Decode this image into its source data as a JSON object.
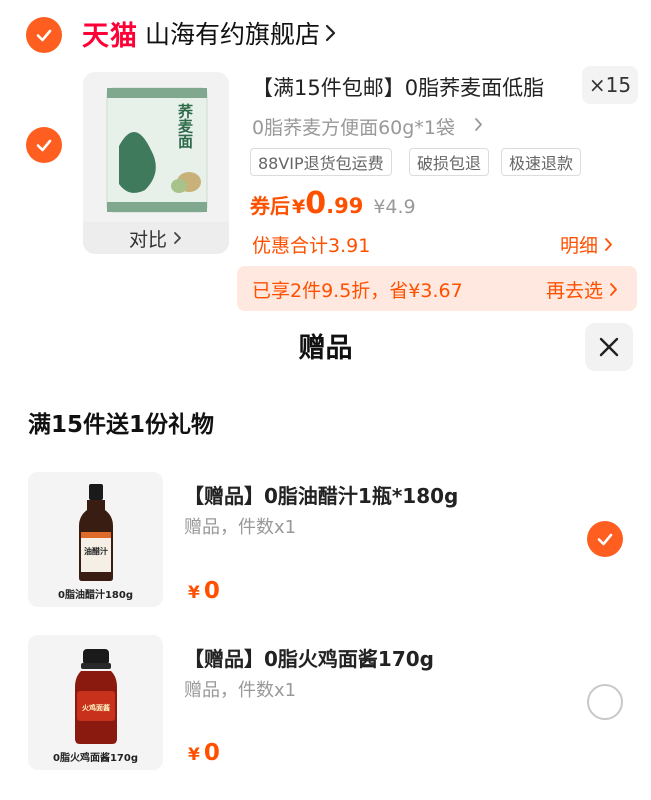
{
  "store": {
    "logo_text": "天猫",
    "name": "山海有约旗舰店"
  },
  "product": {
    "title": "【满15件包邮】0脂荞麦面低脂",
    "quantity": "×15",
    "sku": "0脂荞麦方便面60g*1袋",
    "thumb_text": "荞麦面",
    "compare_label": "对比",
    "tags": [
      "88VIP退货包运费",
      "破损包退",
      "极速退款"
    ],
    "price": {
      "label": "券后",
      "currency": "¥",
      "integer": "0",
      "decimal": ".99",
      "original": "¥4.9"
    },
    "discount_total": "优惠合计3.91",
    "detail_link": "明细",
    "promo": {
      "text": "已享2件9.5折，省¥3.67",
      "link": "再去选"
    }
  },
  "gift_sheet": {
    "title": "赠品",
    "rule": "满15件送1份礼物",
    "gifts": [
      {
        "name": "【赠品】0脂油醋汁1瓶*180g",
        "sub": "赠品，件数x1",
        "currency": "¥",
        "price": "0",
        "image_caption": "0脂油醋汁180g",
        "label_text": "油醋汁",
        "selected": true
      },
      {
        "name": "【赠品】0脂火鸡面酱170g",
        "sub": "赠品，件数x1",
        "currency": "¥",
        "price": "0",
        "image_caption": "0脂火鸡面酱170g",
        "label_text": "火鸡面酱",
        "selected": false
      }
    ]
  },
  "colors": {
    "accent": "#ff5000",
    "check": "#fe5e1f",
    "tmall_red": "#ff0036",
    "promo_bg": "#ffe8df"
  },
  "icons": {
    "store_check": "check-icon",
    "item_check": "check-icon",
    "chevron": "chevron-right-icon",
    "close": "close-icon"
  }
}
